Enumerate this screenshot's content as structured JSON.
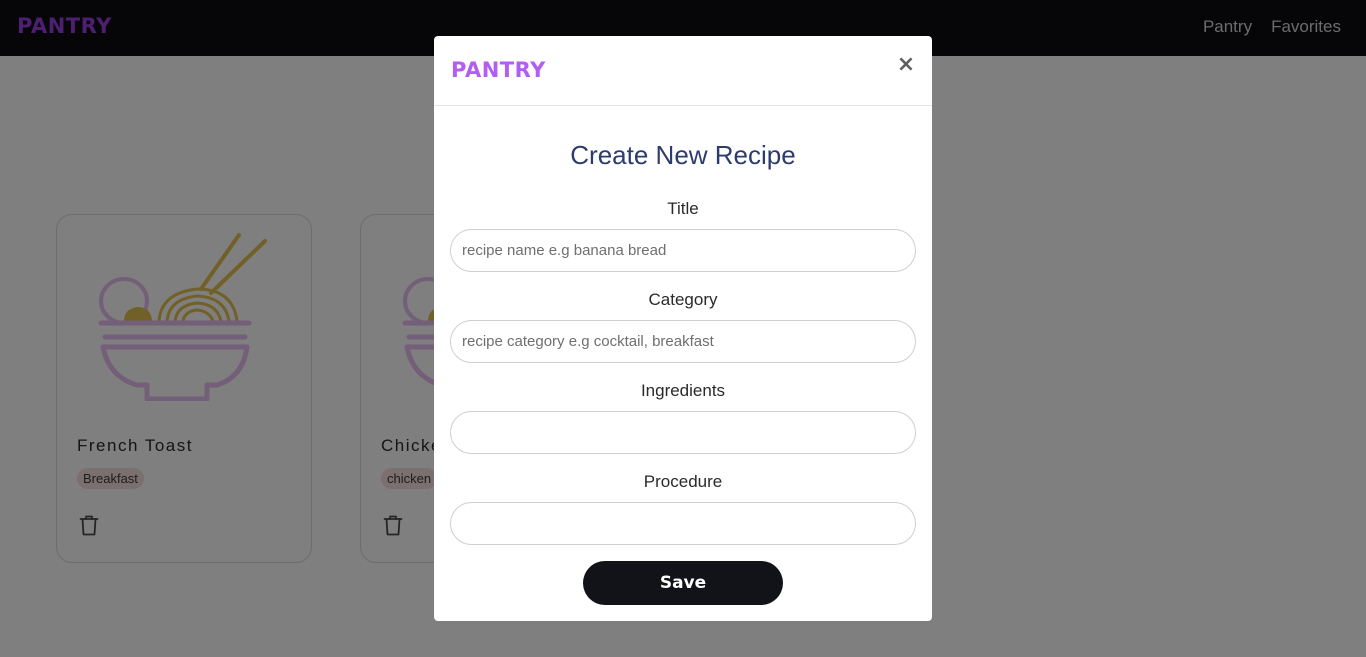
{
  "navbar": {
    "brand": "PANTRY",
    "links": [
      "Pantry",
      "Favorites"
    ]
  },
  "cards": [
    {
      "title": "French Toast",
      "category": "Breakfast",
      "image_icon": "noodle-bowl-icon",
      "delete_icon": "trash-icon"
    },
    {
      "title": "Chicke",
      "category": "chicken",
      "image_icon": "noodle-bowl-icon",
      "delete_icon": "trash-icon"
    }
  ],
  "modal": {
    "brand": "PANTRY",
    "close_label": "×",
    "title": "Create New Recipe",
    "fields": {
      "title": {
        "label": "Title",
        "placeholder": "recipe name e.g banana bread",
        "value": ""
      },
      "category": {
        "label": "Category",
        "placeholder": "recipe category e.g cocktail, breakfast",
        "value": ""
      },
      "ingredients": {
        "label": "Ingredients",
        "placeholder": "",
        "value": ""
      },
      "procedure": {
        "label": "Procedure",
        "placeholder": "",
        "value": ""
      }
    },
    "save_label": "Save"
  },
  "colors": {
    "brand": "#9b3fe0",
    "modal_brand": "#b35ef2",
    "navbar_bg": "#0c0d10",
    "title": "#2d3b6e",
    "save_button_bg": "#111318",
    "icon_gold": "#e3c04e",
    "icon_lilac": "#e6bff0"
  }
}
